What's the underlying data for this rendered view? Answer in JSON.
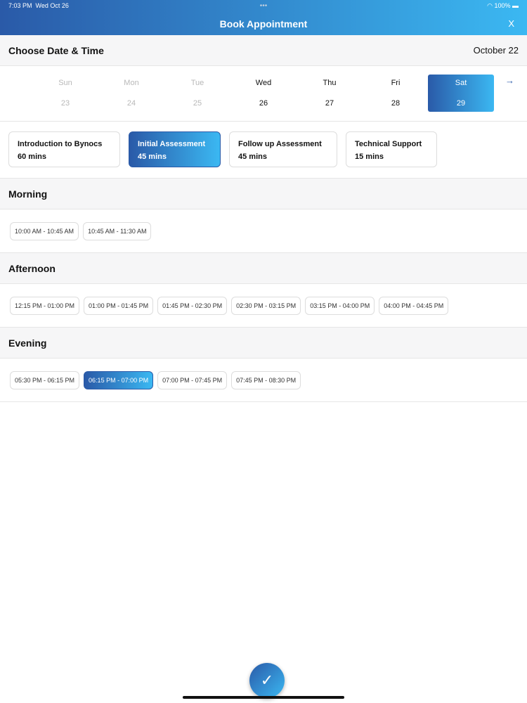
{
  "status": {
    "time": "7:03 PM",
    "date": "Wed Oct 26",
    "battery": "100%"
  },
  "header": {
    "title": "Book Appointment",
    "close": "X"
  },
  "date_section": {
    "title": "Choose Date & Time",
    "month": "October 22"
  },
  "days": [
    {
      "w": "Sun",
      "n": "23"
    },
    {
      "w": "Mon",
      "n": "24"
    },
    {
      "w": "Tue",
      "n": "25"
    },
    {
      "w": "Wed",
      "n": "26"
    },
    {
      "w": "Thu",
      "n": "27"
    },
    {
      "w": "Fri",
      "n": "28"
    },
    {
      "w": "Sat",
      "n": "29"
    }
  ],
  "types": [
    {
      "name": "Introduction to Bynocs",
      "dur": "60 mins"
    },
    {
      "name": "Initial Assessment",
      "dur": "45 mins"
    },
    {
      "name": "Follow up Assessment",
      "dur": "45 mins"
    },
    {
      "name": "Technical Support",
      "dur": "15 mins"
    }
  ],
  "morning": {
    "title": "Morning",
    "slots": [
      "10:00 AM - 10:45 AM",
      "10:45 AM - 11:30 AM"
    ]
  },
  "afternoon": {
    "title": "Afternoon",
    "slots": [
      "12:15 PM - 01:00 PM",
      "01:00 PM - 01:45 PM",
      "01:45 PM - 02:30 PM",
      "02:30 PM - 03:15 PM",
      "03:15 PM - 04:00 PM",
      "04:00 PM - 04:45 PM"
    ]
  },
  "evening": {
    "title": "Evening",
    "slots": [
      "05:30 PM - 06:15 PM",
      "06:15 PM - 07:00 PM",
      "07:00 PM - 07:45 PM",
      "07:45 PM - 08:30 PM"
    ]
  }
}
